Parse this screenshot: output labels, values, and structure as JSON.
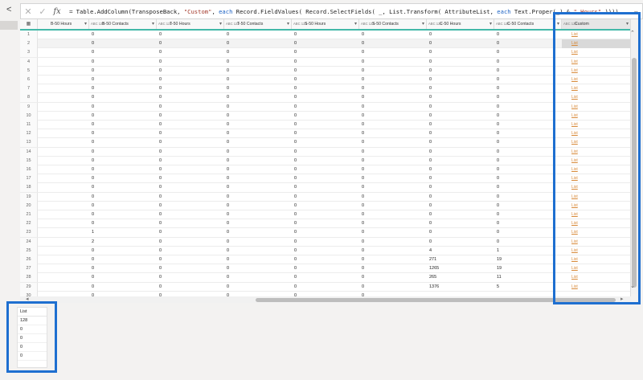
{
  "formula": {
    "cancel_icon": "✕",
    "commit_icon": "✓",
    "fx_label": "fx",
    "equals": "=",
    "parts": [
      {
        "t": "Table.AddColumn(TransposeBack, ",
        "c": ""
      },
      {
        "t": "\"Custom\"",
        "c": "str"
      },
      {
        "t": ", ",
        "c": ""
      },
      {
        "t": "each",
        "c": "kw"
      },
      {
        "t": " Record.FieldValues( Record.SelectFields( _, List.Transform( AttributeList, ",
        "c": ""
      },
      {
        "t": "each",
        "c": "kw"
      },
      {
        "t": " Text.Proper(_) & ",
        "c": ""
      },
      {
        "t": "\" Hours\"",
        "c": "str"
      },
      {
        "t": " ))))",
        "c": ""
      }
    ]
  },
  "columns": [
    {
      "label": "B-50 Hours",
      "type": ""
    },
    {
      "label": "B-50 Contacts",
      "type": "ABC 123"
    },
    {
      "label": "T-50 Hours",
      "type": "ABC 123"
    },
    {
      "label": "T-50 Contacts",
      "type": "ABC 123"
    },
    {
      "label": "S-50 Hours",
      "type": "ABC 123"
    },
    {
      "label": "S-50 Contacts",
      "type": "ABC 123"
    },
    {
      "label": "C-50 Hours",
      "type": "ABC 123"
    },
    {
      "label": "C-50 Contacts",
      "type": "ABC 123"
    },
    {
      "label": "Custom",
      "type": "ABC 123"
    }
  ],
  "list_label": "List",
  "rows": [
    {
      "n": "1",
      "v": [
        "",
        "0",
        "0",
        "0",
        "0",
        "0",
        "0",
        "0"
      ]
    },
    {
      "n": "2",
      "v": [
        "",
        "0",
        "0",
        "0",
        "0",
        "0",
        "0",
        "0"
      ]
    },
    {
      "n": "3",
      "v": [
        "",
        "0",
        "0",
        "0",
        "0",
        "0",
        "0",
        "0"
      ]
    },
    {
      "n": "4",
      "v": [
        "",
        "0",
        "0",
        "0",
        "0",
        "0",
        "0",
        "0"
      ]
    },
    {
      "n": "5",
      "v": [
        "",
        "0",
        "0",
        "0",
        "0",
        "0",
        "0",
        "0"
      ]
    },
    {
      "n": "6",
      "v": [
        "",
        "0",
        "0",
        "0",
        "0",
        "0",
        "0",
        "0"
      ]
    },
    {
      "n": "7",
      "v": [
        "",
        "0",
        "0",
        "0",
        "0",
        "0",
        "0",
        "0"
      ]
    },
    {
      "n": "8",
      "v": [
        "",
        "0",
        "0",
        "0",
        "0",
        "0",
        "0",
        "0"
      ]
    },
    {
      "n": "9",
      "v": [
        "",
        "0",
        "0",
        "0",
        "0",
        "0",
        "0",
        "0"
      ]
    },
    {
      "n": "10",
      "v": [
        "",
        "0",
        "0",
        "0",
        "0",
        "0",
        "0",
        "0"
      ]
    },
    {
      "n": "11",
      "v": [
        "",
        "0",
        "0",
        "0",
        "0",
        "0",
        "0",
        "0"
      ]
    },
    {
      "n": "12",
      "v": [
        "",
        "0",
        "0",
        "0",
        "0",
        "0",
        "0",
        "0"
      ]
    },
    {
      "n": "13",
      "v": [
        "",
        "0",
        "0",
        "0",
        "0",
        "0",
        "0",
        "0"
      ]
    },
    {
      "n": "14",
      "v": [
        "",
        "0",
        "0",
        "0",
        "0",
        "0",
        "0",
        "0"
      ]
    },
    {
      "n": "15",
      "v": [
        "",
        "0",
        "0",
        "0",
        "0",
        "0",
        "0",
        "0"
      ]
    },
    {
      "n": "16",
      "v": [
        "",
        "0",
        "0",
        "0",
        "0",
        "0",
        "0",
        "0"
      ]
    },
    {
      "n": "17",
      "v": [
        "",
        "0",
        "0",
        "0",
        "0",
        "0",
        "0",
        "0"
      ]
    },
    {
      "n": "18",
      "v": [
        "",
        "0",
        "0",
        "0",
        "0",
        "0",
        "0",
        "0"
      ]
    },
    {
      "n": "19",
      "v": [
        "",
        "0",
        "0",
        "0",
        "0",
        "0",
        "0",
        "0"
      ]
    },
    {
      "n": "20",
      "v": [
        "",
        "0",
        "0",
        "0",
        "0",
        "0",
        "0",
        "0"
      ]
    },
    {
      "n": "21",
      "v": [
        "",
        "0",
        "0",
        "0",
        "0",
        "0",
        "0",
        "0"
      ]
    },
    {
      "n": "22",
      "v": [
        "",
        "0",
        "0",
        "0",
        "0",
        "0",
        "0",
        "0"
      ]
    },
    {
      "n": "23",
      "v": [
        "",
        "1",
        "0",
        "0",
        "0",
        "0",
        "0",
        "0"
      ]
    },
    {
      "n": "24",
      "v": [
        "",
        "2",
        "0",
        "0",
        "0",
        "0",
        "0",
        "0"
      ]
    },
    {
      "n": "25",
      "v": [
        "",
        "0",
        "0",
        "0",
        "0",
        "0",
        "4",
        "1"
      ]
    },
    {
      "n": "26",
      "v": [
        "",
        "0",
        "0",
        "0",
        "0",
        "0",
        "271",
        "19"
      ]
    },
    {
      "n": "27",
      "v": [
        "",
        "0",
        "0",
        "0",
        "0",
        "0",
        "1265",
        "19"
      ]
    },
    {
      "n": "28",
      "v": [
        "",
        "0",
        "0",
        "0",
        "0",
        "0",
        "265",
        "11"
      ]
    },
    {
      "n": "29",
      "v": [
        "",
        "0",
        "0",
        "0",
        "0",
        "0",
        "1376",
        "5"
      ]
    },
    {
      "n": "30",
      "v": [
        "",
        "0",
        "0",
        "0",
        "0",
        "0",
        "",
        ""
      ]
    }
  ],
  "preview": {
    "header": "List",
    "items": [
      "128",
      "0",
      "0",
      "0",
      "0"
    ]
  },
  "colors": {
    "highlight": "#1e6fd0",
    "header_underline": "#43b8a8",
    "list_link": "#d88a3a"
  }
}
